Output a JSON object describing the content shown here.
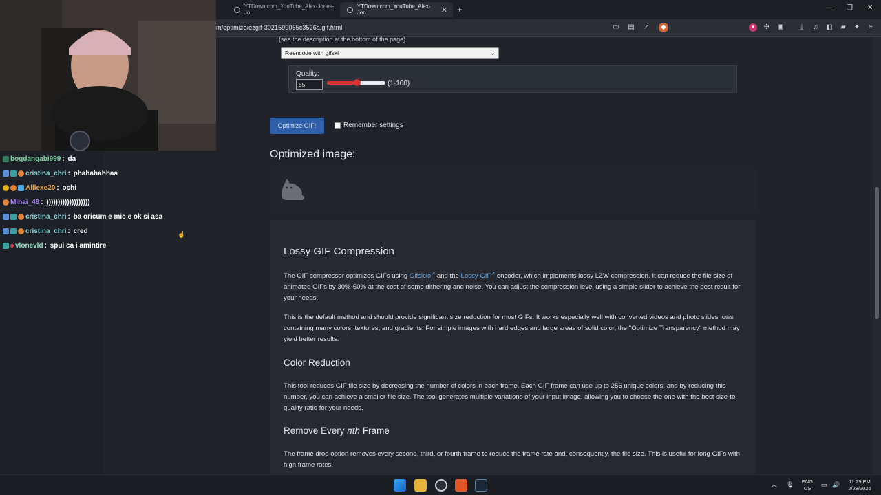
{
  "browser": {
    "tabs": [
      {
        "title": "YTDown.com_YouTube_Alex-Jones-Jo",
        "active": false
      },
      {
        "title": "YTDown.com_YouTube_Alex-Jon",
        "active": true
      }
    ],
    "address": "m/optimize/ezgif-3021599065c3526a.gif.html"
  },
  "optimizer": {
    "description_note": "(see the description at the bottom of the page)",
    "method_selected": "Reencode with gifski",
    "quality_label": "Quality:",
    "quality_value": "55",
    "quality_fraction": 0.52,
    "range_note": "(1-100)",
    "optimize_button": "Optimize GIF!",
    "remember_label": "Remember settings",
    "optimized_heading": "Optimized image:"
  },
  "article": {
    "h_lossy": "Lossy GIF Compression",
    "p1_a": "The GIF compressor optimizes GIFs using ",
    "p1_link1": "Gifsicle",
    "p1_b": " and the ",
    "p1_link2": "Lossy GIF",
    "p1_c": " encoder, which implements lossy LZW compression. It can reduce the file size of animated GIFs by 30%-50% at the cost of some dithering and noise. You can adjust the compression level using a simple slider to achieve the best result for your needs.",
    "p2": "This is the default method and should provide significant size reduction for most GIFs. It works especially well with converted videos and photo slideshows containing many colors, textures, and gradients. For simple images with hard edges and large areas of solid color, the \"Optimize Transparency\" method may yield better results.",
    "h_color": "Color Reduction",
    "p3": "This tool reduces GIF file size by decreasing the number of colors in each frame. Each GIF frame can use up to 256 unique colors, and by reducing this number, you can achieve a smaller file size. The tool generates multiple variations of your input image, allowing you to choose the one with the best size-to-quality ratio for your needs.",
    "h_remove_a": "Remove Every ",
    "h_remove_em": "nth",
    "h_remove_b": " Frame",
    "p4": "The frame drop option removes every second, third, or fourth frame to reduce the frame rate and, consequently, the file size. This is useful for long GIFs with high frame rates."
  },
  "chat": [
    {
      "user": "bogdangabi999",
      "message": "da",
      "color": "#7fd3a5"
    },
    {
      "user": "cristina_chri",
      "message": "phahahahhaa",
      "color": "#8ad7d7"
    },
    {
      "user": "Alllexe20",
      "message": "ochi",
      "color": "#f0a541"
    },
    {
      "user": "Mihai_48",
      "message": ")))))))))))))))))))",
      "color": "#b08cf6"
    },
    {
      "user": "cristina_chri",
      "message": "ba oricum e mic e ok si asa",
      "color": "#8ad7d7"
    },
    {
      "user": "cristina_chri",
      "message": "cred",
      "color": "#8ad7d7"
    },
    {
      "user": "vlonevld",
      "message": "spui ca i amintire",
      "color": "#8fe0c2"
    }
  ],
  "taskbar": {
    "lang_top": "ENG",
    "lang_bottom": "US",
    "time": "11:29 PM",
    "date": "2/28/2026"
  },
  "icons": {
    "tab_favicon": "globe-icon",
    "new_tab": "plus-icon",
    "webcam": "webcam-feed",
    "preview": "cat-placeholder-icon"
  }
}
